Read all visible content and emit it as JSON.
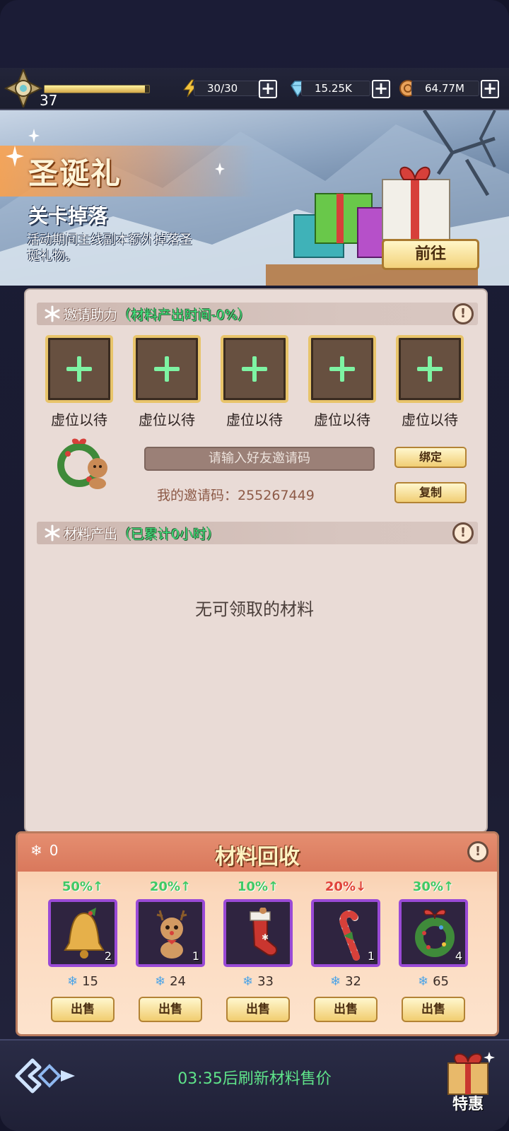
{
  "topbar": {
    "level": "37",
    "xp_progress": 0.96,
    "energy": "30/30",
    "gems": "15.25K",
    "coins": "64.77M",
    "icons": [
      "level-emblem-icon",
      "lightning-icon",
      "diamond-icon",
      "coin-icon",
      "plus-icon"
    ]
  },
  "banner": {
    "title": "圣诞礼",
    "subtitle": "关卡掉落",
    "description": "活动期间主线副本额外掉落圣诞礼物。",
    "go_button": "前往"
  },
  "invite": {
    "header": "邀请助力",
    "header_note": "（材料产出时间-0%）",
    "slots": [
      "虚位以待",
      "虚位以待",
      "虚位以待",
      "虚位以待",
      "虚位以待"
    ],
    "input_placeholder": "请输入好友邀请码",
    "bind_button": "绑定",
    "copy_button": "复制",
    "my_code": "我的邀请码：255267449"
  },
  "materials": {
    "header": "材料产出",
    "header_note": "（已累计0小时）",
    "empty_message": "无可领取的材料"
  },
  "recycle": {
    "title": "材料回收",
    "snowflake_count": "0",
    "items": [
      {
        "name": "bell",
        "change": "50%↑",
        "direction": "up",
        "qty": "2",
        "price": "15",
        "sell": "出售"
      },
      {
        "name": "reindeer",
        "change": "20%↑",
        "direction": "up",
        "qty": "1",
        "price": "24",
        "sell": "出售"
      },
      {
        "name": "stocking",
        "change": "10%↑",
        "direction": "up",
        "qty": "",
        "price": "33",
        "sell": "出售"
      },
      {
        "name": "candy-cane",
        "change": "20%↓",
        "direction": "down",
        "qty": "1",
        "price": "32",
        "sell": "出售"
      },
      {
        "name": "wreath",
        "change": "30%↑",
        "direction": "up",
        "qty": "4",
        "price": "65",
        "sell": "出售"
      }
    ]
  },
  "bottom": {
    "timer": "03:35后刷新材料售价",
    "special_label": "特惠"
  },
  "colors": {
    "accent_green": "#5fe48a",
    "rise_green": "#3fc965",
    "fall_red": "#e0433a",
    "gold": "#f1ce74",
    "slot_border": "#e8c46a",
    "item_border": "#9a4ad6"
  }
}
